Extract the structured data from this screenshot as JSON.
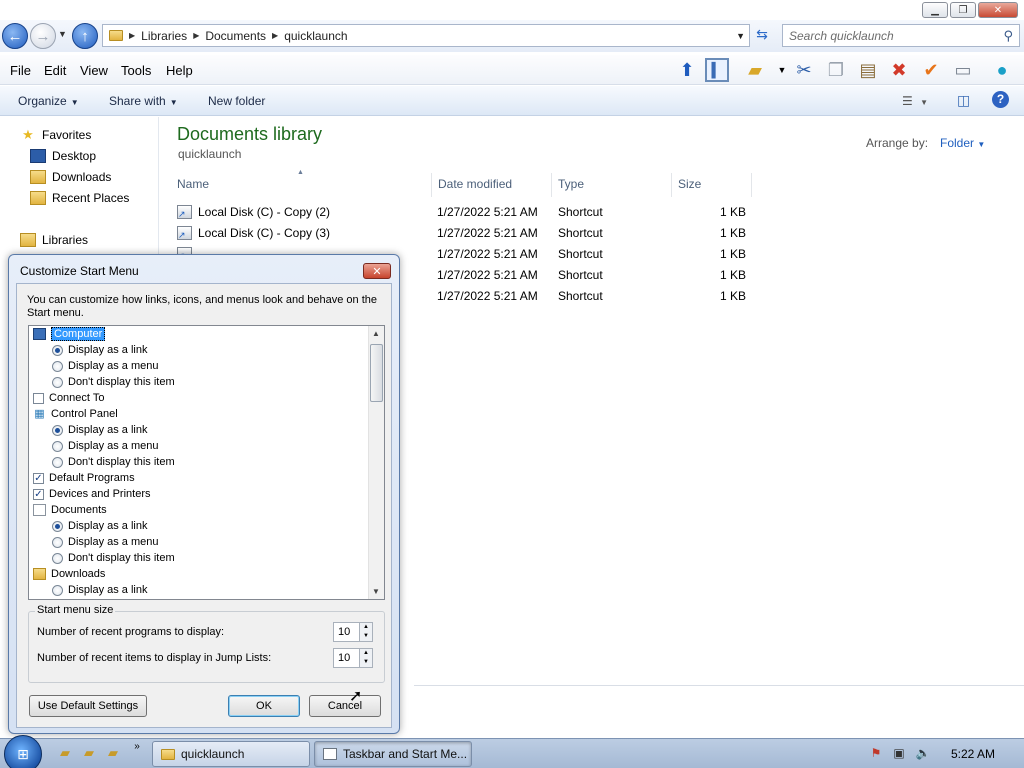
{
  "address": {
    "crumbs": [
      "Libraries",
      "Documents",
      "quicklaunch"
    ],
    "search_placeholder": "Search quicklaunch"
  },
  "menu": [
    "File",
    "Edit",
    "View",
    "Tools",
    "Help"
  ],
  "commands": {
    "organize": "Organize",
    "share_with": "Share with",
    "new_folder": "New folder"
  },
  "nav": {
    "favorites": "Favorites",
    "desktop": "Desktop",
    "downloads": "Downloads",
    "recent_places": "Recent Places",
    "libraries": "Libraries"
  },
  "library": {
    "title": "Documents library",
    "subtitle": "quicklaunch",
    "arrange_label": "Arrange by:",
    "arrange_value": "Folder"
  },
  "columns": [
    "Name",
    "Date modified",
    "Type",
    "Size"
  ],
  "files": [
    {
      "name": "Local Disk (C) - Copy (2)",
      "date": "1/27/2022 5:21 AM",
      "type": "Shortcut",
      "size": "1 KB"
    },
    {
      "name": "Local Disk (C) - Copy (3)",
      "date": "1/27/2022 5:21 AM",
      "type": "Shortcut",
      "size": "1 KB"
    },
    {
      "name": "",
      "date": "1/27/2022 5:21 AM",
      "type": "Shortcut",
      "size": "1 KB"
    },
    {
      "name": "",
      "date": "1/27/2022 5:21 AM",
      "type": "Shortcut",
      "size": "1 KB"
    },
    {
      "name": "",
      "date": "1/27/2022 5:21 AM",
      "type": "Shortcut",
      "size": "1 KB"
    }
  ],
  "dialog": {
    "title": "Customize Start Menu",
    "description": "You can customize how links, icons, and menus look and behave on the Start menu.",
    "items": {
      "computer": "Computer",
      "display_link": "Display as a link",
      "display_menu": "Display as a menu",
      "dont_display": "Don't display this item",
      "connect_to": "Connect To",
      "control_panel": "Control Panel",
      "default_programs": "Default Programs",
      "devices_printers": "Devices and Printers",
      "documents": "Documents",
      "downloads": "Downloads"
    },
    "size_group": {
      "legend": "Start menu size",
      "recent_programs_label": "Number of recent programs to display:",
      "recent_programs_value": "10",
      "jump_list_label": "Number of recent items to display in Jump Lists:",
      "jump_list_value": "10"
    },
    "buttons": {
      "default": "Use Default Settings",
      "ok": "OK",
      "cancel": "Cancel"
    }
  },
  "taskbar": {
    "tasks": [
      "quicklaunch",
      "Taskbar and Start Me..."
    ],
    "clock": "5:22 AM"
  },
  "colors": {
    "library_title": "#1e6a1e",
    "link_blue": "#1f5fbf",
    "selection": "#3399ff"
  }
}
